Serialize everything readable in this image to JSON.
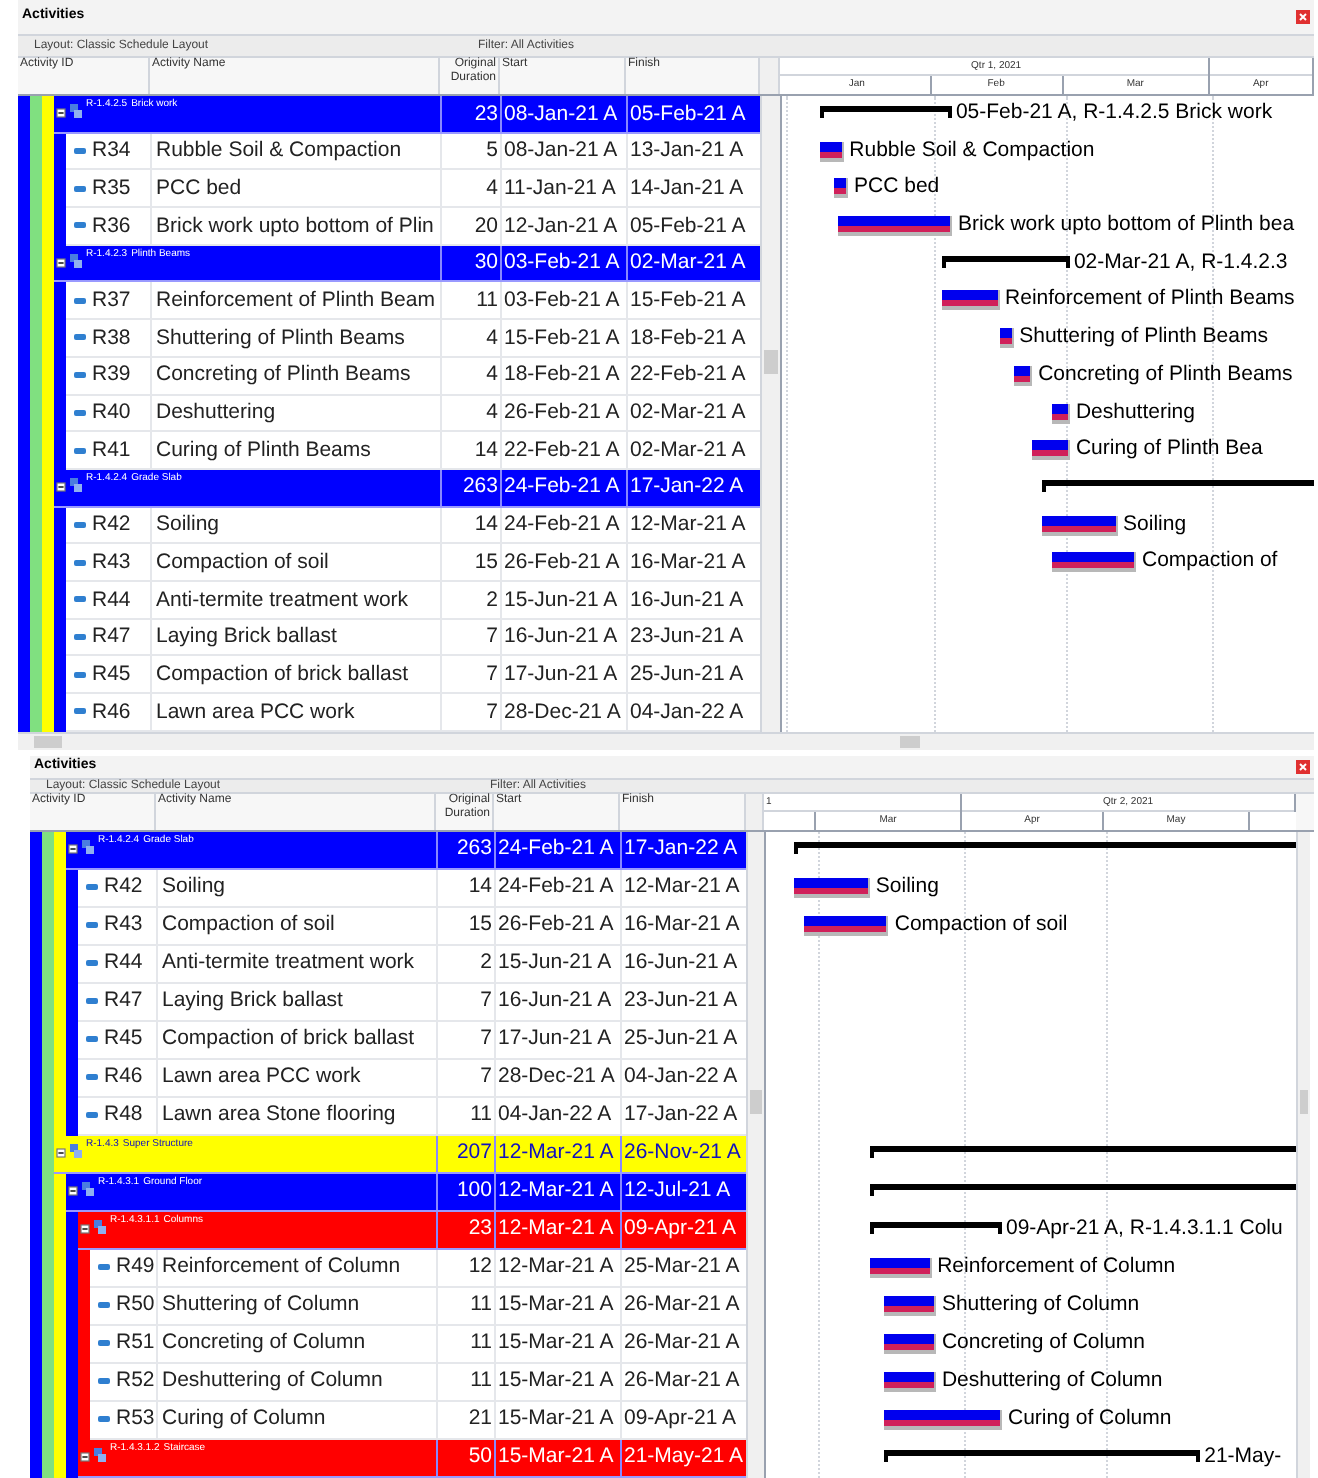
{
  "panels": [
    {
      "title": "Activities",
      "layout": "Layout: Classic Schedule Layout",
      "filter": "Filter: All Activities",
      "columns": [
        "Activity ID",
        "Activity Name",
        "Original Duration",
        "Start",
        "Finish"
      ],
      "timeline": {
        "quarters": [
          "Qtr 1, 2021"
        ],
        "months": [
          "Jan",
          "Feb",
          "Mar",
          "Apr"
        ]
      },
      "rows": [
        {
          "kind": "group",
          "color": "#0000ff",
          "children": [
            {
              "kind": "group",
              "color": "#80e080",
              "children": [
                {
                  "kind": "group",
                  "color": "#ffff00",
                  "children": [
                    {
                      "kind": "wbs",
                      "code": "R-1.4.2.5",
                      "name": "Brick work",
                      "duration": "23",
                      "start": "08-Jan-21 A",
                      "finish": "05-Feb-21 A",
                      "color": "#0000ff",
                      "expanded": true,
                      "bar_label": "05-Feb-21 A, R-1.4.2.5  Brick work",
                      "children": [
                        {
                          "kind": "activity",
                          "id": "R34",
                          "name": "Rubble Soil & Compaction",
                          "duration": "5",
                          "start": "08-Jan-21 A",
                          "finish": "13-Jan-21 A",
                          "bar_label": "Rubble Soil & Compaction"
                        },
                        {
                          "kind": "activity",
                          "id": "R35",
                          "name": "PCC bed",
                          "duration": "4",
                          "start": "11-Jan-21 A",
                          "finish": "14-Jan-21 A",
                          "bar_label": "PCC bed"
                        },
                        {
                          "kind": "activity",
                          "id": "R36",
                          "name": "Brick work upto bottom of Plin",
                          "duration": "20",
                          "start": "12-Jan-21 A",
                          "finish": "05-Feb-21 A",
                          "bar_label": "Brick work upto bottom of Plinth bea"
                        }
                      ]
                    },
                    {
                      "kind": "wbs",
                      "code": "R-1.4.2.3",
                      "name": "Plinth Beams",
                      "duration": "30",
                      "start": "03-Feb-21 A",
                      "finish": "02-Mar-21 A",
                      "color": "#0000ff",
                      "expanded": true,
                      "bar_label": "02-Mar-21 A, R-1.4.2.3",
                      "children": [
                        {
                          "kind": "activity",
                          "id": "R37",
                          "name": "Reinforcement of Plinth Beam",
                          "duration": "11",
                          "start": "03-Feb-21 A",
                          "finish": "15-Feb-21 A",
                          "bar_label": "Reinforcement of Plinth Beams"
                        },
                        {
                          "kind": "activity",
                          "id": "R38",
                          "name": "Shuttering of Plinth Beams",
                          "duration": "4",
                          "start": "15-Feb-21 A",
                          "finish": "18-Feb-21 A",
                          "bar_label": "Shuttering of Plinth Beams"
                        },
                        {
                          "kind": "activity",
                          "id": "R39",
                          "name": "Concreting of Plinth Beams",
                          "duration": "4",
                          "start": "18-Feb-21 A",
                          "finish": "22-Feb-21 A",
                          "bar_label": "Concreting of Plinth Beams"
                        },
                        {
                          "kind": "activity",
                          "id": "R40",
                          "name": "Deshuttering",
                          "duration": "4",
                          "start": "26-Feb-21 A",
                          "finish": "02-Mar-21 A",
                          "bar_label": "Deshuttering"
                        },
                        {
                          "kind": "activity",
                          "id": "R41",
                          "name": "Curing of Plinth Beams",
                          "duration": "14",
                          "start": "22-Feb-21 A",
                          "finish": "02-Mar-21 A",
                          "bar_label": "Curing of Plinth Bea"
                        }
                      ]
                    },
                    {
                      "kind": "wbs",
                      "code": "R-1.4.2.4",
                      "name": "Grade Slab",
                      "duration": "263",
                      "start": "24-Feb-21 A",
                      "finish": "17-Jan-22 A",
                      "color": "#0000ff",
                      "expanded": true,
                      "children": [
                        {
                          "kind": "activity",
                          "id": "R42",
                          "name": "Soiling",
                          "duration": "14",
                          "start": "24-Feb-21 A",
                          "finish": "12-Mar-21 A",
                          "bar_label": "Soiling"
                        },
                        {
                          "kind": "activity",
                          "id": "R43",
                          "name": "Compaction of  soil",
                          "duration": "15",
                          "start": "26-Feb-21 A",
                          "finish": "16-Mar-21 A",
                          "bar_label": "Compaction of"
                        },
                        {
                          "kind": "activity",
                          "id": "R44",
                          "name": "Anti-termite treatment work",
                          "duration": "2",
                          "start": "15-Jun-21 A",
                          "finish": "16-Jun-21 A"
                        },
                        {
                          "kind": "activity",
                          "id": "R47",
                          "name": "Laying Brick ballast",
                          "duration": "7",
                          "start": "16-Jun-21 A",
                          "finish": "23-Jun-21 A"
                        },
                        {
                          "kind": "activity",
                          "id": "R45",
                          "name": "Compaction of brick ballast",
                          "duration": "7",
                          "start": "17-Jun-21 A",
                          "finish": "25-Jun-21 A"
                        },
                        {
                          "kind": "activity",
                          "id": "R46",
                          "name": "Lawn area PCC  work",
                          "duration": "7",
                          "start": "28-Dec-21 A",
                          "finish": "04-Jan-22 A"
                        }
                      ]
                    }
                  ]
                }
              ]
            }
          ]
        }
      ]
    },
    {
      "title": "Activities",
      "layout": "Layout: Classic Schedule Layout",
      "filter": "Filter: All Activities",
      "columns": [
        "Activity ID",
        "Activity Name",
        "Original Duration",
        "Start",
        "Finish"
      ],
      "timeline": {
        "quarters": [
          "1",
          "Qtr 2, 2021"
        ],
        "months": [
          "Mar",
          "Apr",
          "May"
        ]
      },
      "rows": [
        {
          "kind": "group",
          "color": "#0000ff",
          "children": [
            {
              "kind": "group",
              "color": "#80e080",
              "children": [
                {
                  "kind": "group",
                  "color": "#ffff00",
                  "children": [
                    {
                      "kind": "wbs",
                      "code": "R-1.4.2.4",
                      "name": "Grade Slab",
                      "duration": "263",
                      "start": "24-Feb-21 A",
                      "finish": "17-Jan-22 A",
                      "color": "#0000ff",
                      "expanded": true,
                      "children": [
                        {
                          "kind": "activity",
                          "id": "R42",
                          "name": "Soiling",
                          "duration": "14",
                          "start": "24-Feb-21 A",
                          "finish": "12-Mar-21 A",
                          "bar_label": "Soiling"
                        },
                        {
                          "kind": "activity",
                          "id": "R43",
                          "name": "Compaction of  soil",
                          "duration": "15",
                          "start": "26-Feb-21 A",
                          "finish": "16-Mar-21 A",
                          "bar_label": "Compaction of  soil"
                        },
                        {
                          "kind": "activity",
                          "id": "R44",
                          "name": "Anti-termite treatment work",
                          "duration": "2",
                          "start": "15-Jun-21 A",
                          "finish": "16-Jun-21 A"
                        },
                        {
                          "kind": "activity",
                          "id": "R47",
                          "name": "Laying Brick ballast",
                          "duration": "7",
                          "start": "16-Jun-21 A",
                          "finish": "23-Jun-21 A"
                        },
                        {
                          "kind": "activity",
                          "id": "R45",
                          "name": "Compaction of brick ballast",
                          "duration": "7",
                          "start": "17-Jun-21 A",
                          "finish": "25-Jun-21 A"
                        },
                        {
                          "kind": "activity",
                          "id": "R46",
                          "name": "Lawn area PCC  work",
                          "duration": "7",
                          "start": "28-Dec-21 A",
                          "finish": "04-Jan-22 A"
                        },
                        {
                          "kind": "activity",
                          "id": "R48",
                          "name": "Lawn area Stone flooring",
                          "duration": "11",
                          "start": "04-Jan-22 A",
                          "finish": "17-Jan-22 A"
                        }
                      ]
                    }
                  ]
                },
                {
                  "kind": "wbs",
                  "code": "R-1.4.3",
                  "name": "Super Structure",
                  "duration": "207",
                  "start": "12-Mar-21 A",
                  "finish": "26-Nov-21 A",
                  "color": "#ffff00",
                  "expanded": true,
                  "children": [
                    {
                      "kind": "wbs",
                      "code": "R-1.4.3.1",
                      "name": "Ground Floor",
                      "duration": "100",
                      "start": "12-Mar-21 A",
                      "finish": "12-Jul-21 A",
                      "color": "#0000ff",
                      "expanded": true,
                      "children": [
                        {
                          "kind": "wbs",
                          "code": "R-1.4.3.1.1",
                          "name": "Columns",
                          "duration": "23",
                          "start": "12-Mar-21 A",
                          "finish": "09-Apr-21 A",
                          "color": "#ff0000",
                          "expanded": true,
                          "bar_label": "09-Apr-21 A, R-1.4.3.1.1  Colu",
                          "children": [
                            {
                              "kind": "activity",
                              "id": "R49",
                              "name": "Reinforcement of Column",
                              "duration": "12",
                              "start": "12-Mar-21 A",
                              "finish": "25-Mar-21 A",
                              "bar_label": "Reinforcement of Column"
                            },
                            {
                              "kind": "activity",
                              "id": "R50",
                              "name": "Shuttering of Column",
                              "duration": "11",
                              "start": "15-Mar-21 A",
                              "finish": "26-Mar-21 A",
                              "bar_label": "Shuttering of Column"
                            },
                            {
                              "kind": "activity",
                              "id": "R51",
                              "name": "Concreting of Column",
                              "duration": "11",
                              "start": "15-Mar-21 A",
                              "finish": "26-Mar-21 A",
                              "bar_label": "Concreting of Column"
                            },
                            {
                              "kind": "activity",
                              "id": "R52",
                              "name": "Deshuttering of Column",
                              "duration": "11",
                              "start": "15-Mar-21 A",
                              "finish": "26-Mar-21 A",
                              "bar_label": "Deshuttering of Column"
                            },
                            {
                              "kind": "activity",
                              "id": "R53",
                              "name": "Curing of Column",
                              "duration": "21",
                              "start": "15-Mar-21 A",
                              "finish": "09-Apr-21 A",
                              "bar_label": "Curing of Column"
                            }
                          ]
                        },
                        {
                          "kind": "wbs",
                          "code": "R-1.4.3.1.2",
                          "name": "Staircase",
                          "duration": "50",
                          "start": "15-Mar-21 A",
                          "finish": "21-May-21 A",
                          "color": "#ff0000",
                          "expanded": true,
                          "bar_label": "21-May-"
                        }
                      ]
                    }
                  ]
                }
              ]
            }
          ]
        }
      ]
    }
  ]
}
